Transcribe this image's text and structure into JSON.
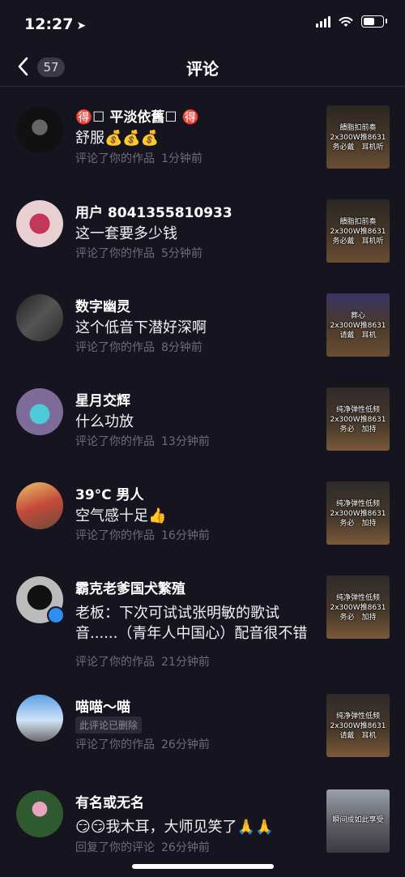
{
  "status": {
    "time": "12:27",
    "location_arrow": "➤"
  },
  "nav": {
    "back_badge": "57",
    "title": "评论"
  },
  "items": [
    {
      "name": "🉐☐ 平淡依舊☐ 🉐",
      "comment": "舒服💰💰💰",
      "meta_action": "评论了你的作品",
      "meta_time": "1分钟前",
      "thumb_caption": "饋脂扣前奏\n2x300W推8631\n务必戴　耳机听"
    },
    {
      "name": "用户 8041355810933",
      "comment": "这一套要多少钱",
      "meta_action": "评论了你的作品",
      "meta_time": "5分钟前",
      "thumb_caption": "饋脂扣前奏\n2x300W推8631\n务必戴　耳机听"
    },
    {
      "name": "数字幽灵",
      "comment": "这个低音下潜好深啊",
      "meta_action": "评论了你的作品",
      "meta_time": "8分钟前",
      "thumb_caption": "葬心\n2x300W推8631\n请戴　耳机"
    },
    {
      "name": "星月交辉",
      "comment": "什么功放",
      "meta_action": "评论了你的作品",
      "meta_time": "13分钟前",
      "thumb_caption": "纯净弹性低频\n2x300W推8631\n务必　加持"
    },
    {
      "name": "39°C 男人",
      "comment": "空气感十足👍",
      "meta_action": "评论了你的作品",
      "meta_time": "16分钟前",
      "thumb_caption": "纯净弹性低频\n2x300W推8631\n务必　加持"
    },
    {
      "name": "霸克老爹国犬繁殖",
      "comment": "老板：下次可试试张明敏的歌试音......（青年人中国心）配音很不错",
      "meta_action": "评论了你的作品",
      "meta_time": "21分钟前",
      "thumb_caption": "纯净弹性低频\n2x300W推8631\n务必　加持"
    },
    {
      "name": "喵喵～喵",
      "deleted": "此评论已删除",
      "meta_action": "评论了你的作品",
      "meta_time": "26分钟前",
      "thumb_caption": "纯净弹性低频\n2x300W推8631\n请戴　耳机"
    },
    {
      "name": "有名或无名",
      "comment": "😏😏我木耳，大师见笑了🙏🙏",
      "meta_action": "回复了你的评论",
      "meta_time": "26分钟前",
      "thumb_caption": "瞬间成如此享受"
    }
  ]
}
